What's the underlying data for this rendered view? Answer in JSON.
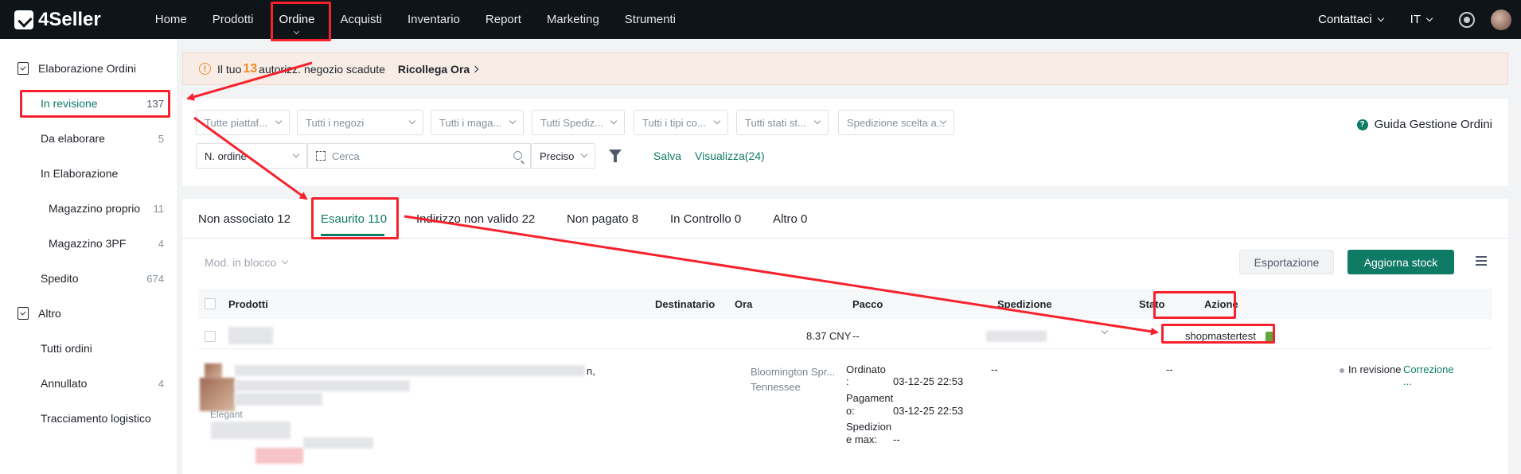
{
  "app": {
    "name": "4Seller"
  },
  "nav": {
    "items": [
      "Home",
      "Prodotti",
      "Ordine",
      "Acquisti",
      "Inventario",
      "Report",
      "Marketing",
      "Strumenti"
    ],
    "contact": "Contattaci",
    "lang": "IT"
  },
  "sidebar": {
    "group1": "Elaborazione Ordini",
    "review": {
      "label": "In revisione",
      "count": "137"
    },
    "process": {
      "label": "Da elaborare",
      "count": "5"
    },
    "inprogress": "In Elaborazione",
    "own_wh": {
      "label": "Magazzino proprio",
      "count": "11"
    },
    "wh3pf": {
      "label": "Magazzino 3PF",
      "count": "4"
    },
    "shipped": {
      "label": "Spedito",
      "count": "674"
    },
    "group2": "Altro",
    "all": "Tutti ordini",
    "cancelled": {
      "label": "Annullato",
      "count": "4"
    },
    "tracking": "Tracciamento logistico"
  },
  "banner": {
    "prefix": "Il tuo",
    "count": "13",
    "suffix": "autorizz. negozio scadute",
    "action": "Ricollega Ora"
  },
  "filters": {
    "platform": "Tutte piattaf...",
    "store": "Tutti i negozi",
    "warehouse": "Tutti i maga...",
    "shipping": "Tutti Spediz...",
    "types": "Tutti i tipi co...",
    "states": "Tutti stati st...",
    "chosen_shipping": "Spedizione scelta a...",
    "guide": "Guida Gestione Ordini",
    "order_field": "N. ordine",
    "search_placeholder": "Cerca",
    "match": "Preciso",
    "save": "Salva",
    "view": "Visualizza(24)"
  },
  "tabs": [
    "Non associato 12",
    "Esaurito 110",
    "Indirizzo non valido 22",
    "Non pagato 8",
    "In Controllo 0",
    "Altro 0"
  ],
  "toolbar": {
    "bulk": "Mod. in blocco",
    "export": "Esportazione",
    "update_stock": "Aggiorna stock"
  },
  "table": {
    "headers": {
      "products": "Prodotti",
      "recipient": "Destinatario",
      "time": "Ora",
      "package": "Pacco",
      "shipping": "Spedizione",
      "status": "Stato",
      "action": "Azione"
    },
    "sub_row": {
      "amount": "8.37 CNY",
      "package": "--",
      "shop": "shopmastertest"
    },
    "row": {
      "product_suffix": "n,",
      "product_word": "Elegant",
      "recipient_city": "Bloomington Spr...",
      "recipient_state": "Tennessee",
      "ordered_label": "Ordinato",
      "ordered_colon": ":",
      "ordered_value": "03-12-25 22:53",
      "paid_label_1": "Pagament",
      "paid_label_2": "o:",
      "paid_value": "03-12-25 22:53",
      "max_label_1": "Spedizion",
      "max_label_2": "e max:",
      "max_value": "--",
      "package": "--",
      "shipping": "--",
      "status": "In revisione",
      "action": "Correzione",
      "more": "..."
    }
  },
  "colors": {
    "accent": "#0f7b65",
    "topbar": "#0f1419",
    "warning": "#f08a24",
    "annotation": "#f5222d"
  }
}
